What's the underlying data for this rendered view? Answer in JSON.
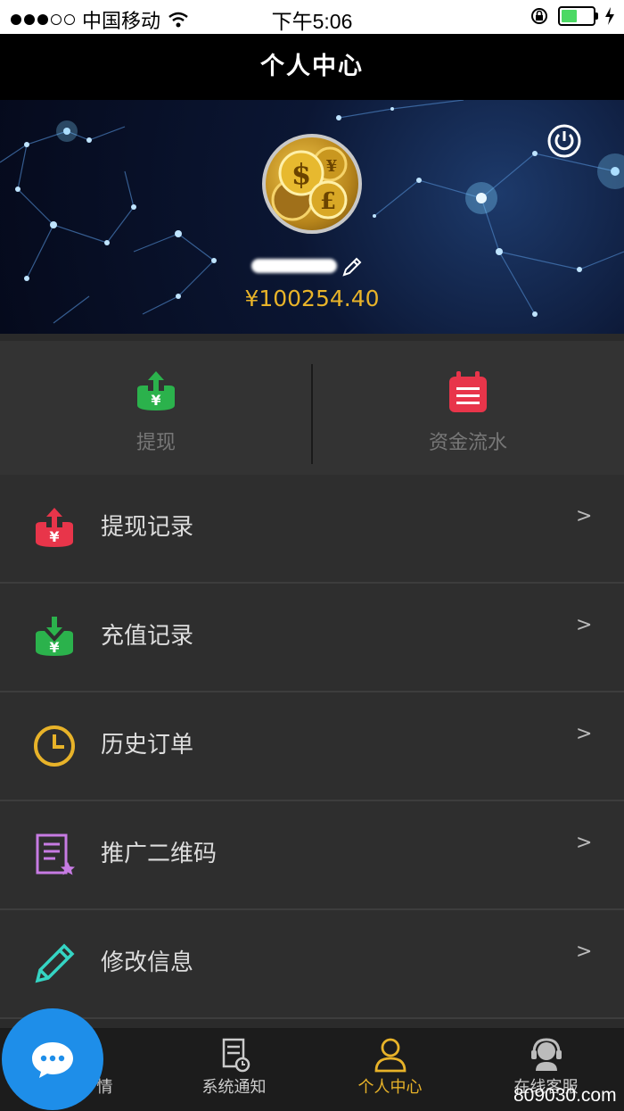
{
  "status_bar": {
    "carrier": "中国移动",
    "time": "下午5:06"
  },
  "nav": {
    "title": "个人中心"
  },
  "profile": {
    "balance": "¥100254.40"
  },
  "quick_actions": [
    {
      "label": "提现",
      "icon": "withdraw-icon",
      "color": "#2bb24c"
    },
    {
      "label": "资金流水",
      "icon": "notepad-icon",
      "color": "#e8354a"
    }
  ],
  "menu": [
    {
      "label": "提现记录",
      "icon": "withdraw-record-icon",
      "chevron": ">"
    },
    {
      "label": "充值记录",
      "icon": "recharge-record-icon",
      "chevron": ">"
    },
    {
      "label": "历史订单",
      "icon": "clock-icon",
      "chevron": ">"
    },
    {
      "label": "推广二维码",
      "icon": "qrcode-document-icon",
      "chevron": ">"
    },
    {
      "label": "修改信息",
      "icon": "pencil-icon",
      "chevron": ">"
    }
  ],
  "tabbar": [
    {
      "label": "情",
      "icon": "chat-icon"
    },
    {
      "label": "系统通知",
      "icon": "notice-icon"
    },
    {
      "label": "个人中心",
      "icon": "user-icon",
      "active": true
    },
    {
      "label": "在线客服",
      "icon": "customer-service-icon"
    }
  ],
  "watermark": "809030.com",
  "colors": {
    "accent": "#e8b329",
    "chat_fab": "#1e8ee9"
  }
}
